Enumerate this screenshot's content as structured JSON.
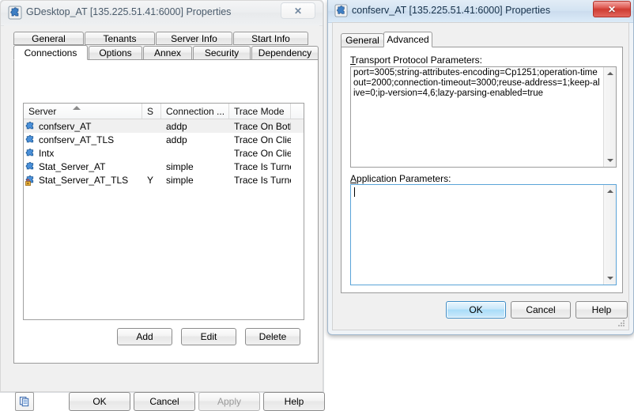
{
  "left_window": {
    "title": "GDesktop_AT [135.225.51.41:6000] Properties",
    "app_icon": "puzzle-piece-icon",
    "close_label": "✕",
    "tabs_row1": [
      {
        "label": "General",
        "selected": false
      },
      {
        "label": "Tenants",
        "selected": false
      },
      {
        "label": "Server Info",
        "selected": false
      },
      {
        "label": "Start Info",
        "selected": false
      }
    ],
    "tabs_row2": [
      {
        "label": "Connections",
        "selected": true
      },
      {
        "label": "Options",
        "selected": false
      },
      {
        "label": "Annex",
        "selected": false
      },
      {
        "label": "Security",
        "selected": false
      },
      {
        "label": "Dependency",
        "selected": false
      }
    ],
    "list": {
      "columns": [
        {
          "label": "Server",
          "sorted": "asc"
        },
        {
          "label": "S",
          "sorted": ""
        },
        {
          "label": "Connection ...",
          "sorted": ""
        },
        {
          "label": "Trace Mode",
          "sorted": ""
        },
        {
          "label": "",
          "sorted": ""
        }
      ],
      "rows": [
        {
          "server": "confserv_AT",
          "s": "",
          "connection": "addp",
          "trace": "Trace On Both ...",
          "icon": "puzzle-piece-icon",
          "selected": true
        },
        {
          "server": "confserv_AT_TLS",
          "s": "",
          "connection": "addp",
          "trace": "Trace On Client...",
          "icon": "puzzle-piece-icon",
          "selected": false
        },
        {
          "server": "Intx",
          "s": "",
          "connection": "",
          "trace": "Trace On Client...",
          "icon": "puzzle-piece-icon",
          "selected": false
        },
        {
          "server": "Stat_Server_AT",
          "s": "",
          "connection": "simple",
          "trace": "Trace Is Turned...",
          "icon": "puzzle-piece-icon",
          "selected": false
        },
        {
          "server": "Stat_Server_AT_TLS",
          "s": "Y",
          "connection": "simple",
          "trace": "Trace Is Turned...",
          "icon": "puzzle-piece-lock-icon",
          "selected": false
        }
      ]
    },
    "list_buttons": [
      {
        "label": "Add",
        "disabled": false
      },
      {
        "label": "Edit",
        "disabled": false
      },
      {
        "label": "Delete",
        "disabled": false
      }
    ],
    "copy_button_icon": "copy-documents-icon",
    "footer_buttons": [
      {
        "label": "OK",
        "disabled": false,
        "default": false
      },
      {
        "label": "Cancel",
        "disabled": false,
        "default": false
      },
      {
        "label": "Apply",
        "disabled": true,
        "default": false
      },
      {
        "label": "Help",
        "disabled": false,
        "default": false
      }
    ]
  },
  "right_window": {
    "title": "confserv_AT [135.225.51.41:6000] Properties",
    "app_icon": "puzzle-piece-icon",
    "close_label": "✕",
    "tabs": [
      {
        "label": "General",
        "selected": false
      },
      {
        "label": "Advanced",
        "selected": true
      }
    ],
    "transport": {
      "label_accel": "T",
      "label_rest": "ransport Protocol Parameters:",
      "value": "port=3005;string-attributes-encoding=Cp1251;operation-timeout=2000;connection-timeout=3000;reuse-address=1;keep-alive=0;ip-version=4,6;lazy-parsing-enabled=true"
    },
    "application": {
      "label_accel": "A",
      "label_rest": "pplication Parameters:",
      "value": "",
      "focused": true
    },
    "footer_buttons": [
      {
        "label": "OK",
        "disabled": false,
        "default": true
      },
      {
        "label": "Cancel",
        "disabled": false,
        "default": false
      },
      {
        "label": "Help",
        "disabled": false,
        "default": false
      }
    ]
  },
  "colors": {
    "active_title": "#d3e3f2",
    "close_red": "#cf3c33",
    "default_button_blue": "#a9dcf8",
    "selection_gray": "#f0f0f0",
    "puzzle_blue": "#4a90d9"
  }
}
